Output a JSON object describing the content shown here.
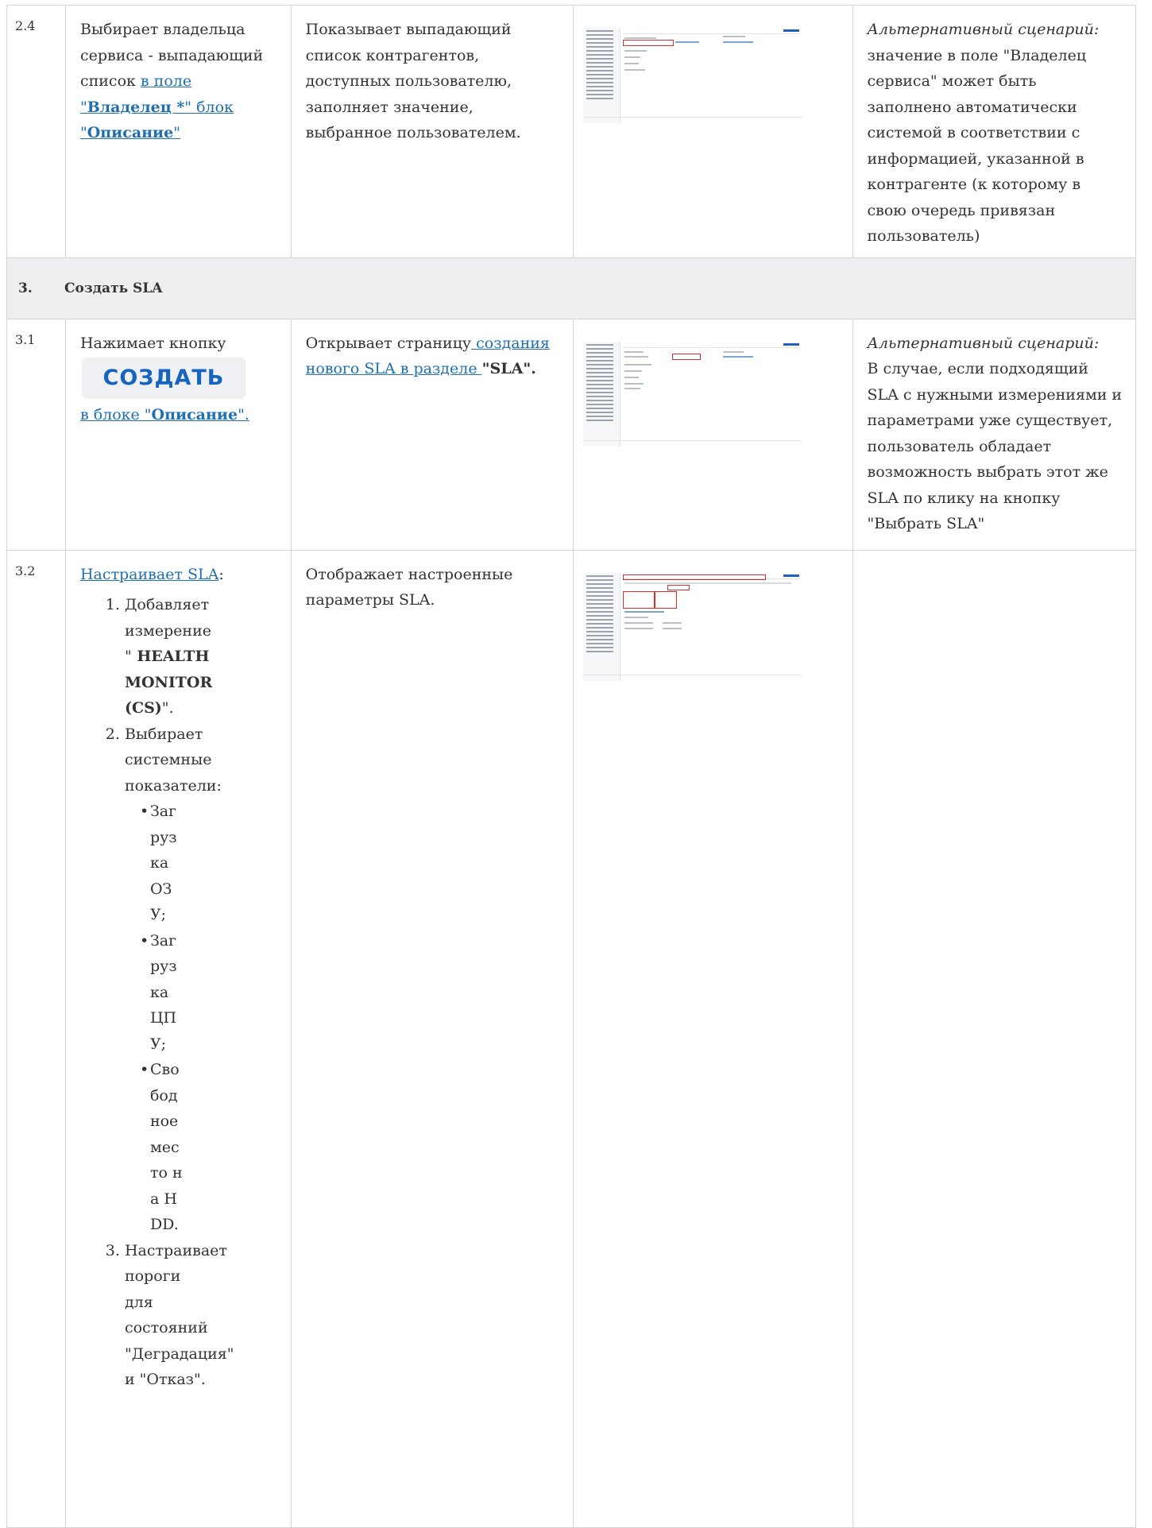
{
  "rows": {
    "r24": {
      "num": "2.4",
      "action_pre": "Выбирает владельца сервиса - выпадающий список ",
      "action_link_a": "в поле \"",
      "action_link_b": "Владелец *",
      "action_link_c": "\" блок \"",
      "action_link_d": "Описание",
      "action_link_e": "\"",
      "response": "Показывает выпадающий список контрагентов, доступных пользователю, заполняет значение, выбранное пользователем.",
      "note_italic": "Альтернативный сценарий:",
      "note_text": " значение в поле \"Владелец сервиса\" может быть заполнено автоматически системой в соответствии с информацией, указанной в контрагенте (к которому в свою очередь привязан пользователь)"
    },
    "section3": {
      "num": "3.",
      "title": "Создать SLA"
    },
    "r31": {
      "num": "3.1",
      "action_pre": "Нажимает кнопку",
      "button_label": "СОЗДАТЬ",
      "action_link_a": "в блоке \"",
      "action_link_b": "Описание",
      "action_link_c": "\".",
      "response_pre": "Открывает страницу",
      "response_link": " создания нового SLA в разделе ",
      "response_bold": "\"SLA\".",
      "note_italic": "Альтернативный сценарий:",
      "note_text": "В случае, если подходящий SLA с нужными измерениями и параметрами уже существует, пользователь обладает возможность выбрать этот же SLA по клику на кнопку \"Выбрать SLA\""
    },
    "r32": {
      "num": "3.2",
      "action_link": "Настраивает SLA",
      "action_colon": ":",
      "step1_a": "Добавляет измерение \"",
      "step1_b": " HEALTH MONITOR (CS)",
      "step1_c": "\".",
      "step2": "Выбирает системные показатели:",
      "sub1": "Загрузка ОЗУ;",
      "sub2": "Загрузка ЦПУ;",
      "sub3": "Свободное место на HDD.",
      "step3": "Настраивает пороги для состояний \"Деградация\" и \"Отказ\".",
      "response": "Отображает настроенные параметры SLA."
    }
  },
  "colors": {
    "link": "#1f6fb2",
    "highlight": "#d32f2f",
    "section_bg": "#eceeef",
    "button_text": "#1565c0"
  }
}
